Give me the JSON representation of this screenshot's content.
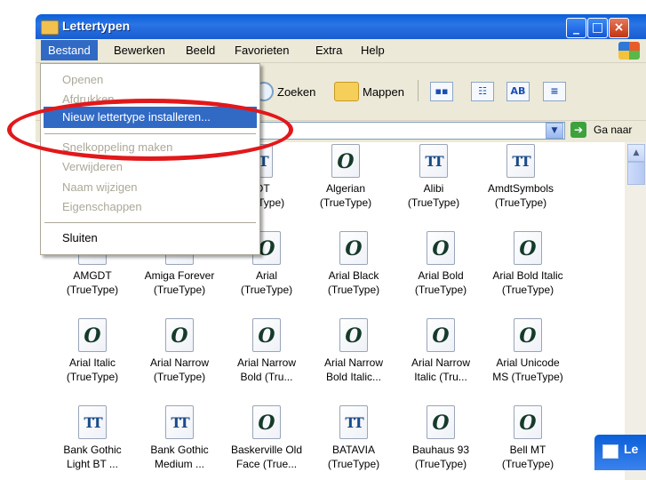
{
  "window": {
    "title": "Lettertypen"
  },
  "menubar": {
    "items": [
      "Bestand",
      "Bewerken",
      "Beeld",
      "Favorieten",
      "Extra",
      "Help"
    ]
  },
  "toolbar": {
    "zoeken": "Zoeken",
    "mappen": "Mappen",
    "view_ab": "AB"
  },
  "addressbar": {
    "go_label": "Ga naar"
  },
  "menu_bestand": {
    "items": [
      "Openen",
      "Afdrukken",
      "Nieuw lettertype installeren...",
      "Snelkoppeling maken",
      "Verwijderen",
      "Naam wijzigen",
      "Eigenschappen",
      "Sluiten"
    ]
  },
  "files": [
    {
      "name": "GDT\n(TrueType)",
      "icon": "tt"
    },
    {
      "name": "Algerian\n(TrueType)",
      "icon": "ot"
    },
    {
      "name": "Alibi\n(TrueType)",
      "icon": "tt"
    },
    {
      "name": "AmdtSymbols\n(TrueType)",
      "icon": "tt"
    },
    {
      "name": "AMGDT\n(TrueType)",
      "icon": "tt"
    },
    {
      "name": "Amiga Forever\n(TrueType)",
      "icon": "tt"
    },
    {
      "name": "Arial\n(TrueType)",
      "icon": "ot"
    },
    {
      "name": "Arial Black\n(TrueType)",
      "icon": "ot"
    },
    {
      "name": "Arial Bold\n(TrueType)",
      "icon": "ot"
    },
    {
      "name": "Arial Bold Italic\n(TrueType)",
      "icon": "ot"
    },
    {
      "name": "Arial Italic\n(TrueType)",
      "icon": "ot"
    },
    {
      "name": "Arial Narrow\n(TrueType)",
      "icon": "ot"
    },
    {
      "name": "Arial Narrow\nBold (Tru...",
      "icon": "ot"
    },
    {
      "name": "Arial Narrow\nBold Italic...",
      "icon": "ot"
    },
    {
      "name": "Arial Narrow\nItalic (Tru...",
      "icon": "ot"
    },
    {
      "name": "Arial Unicode\nMS (TrueType)",
      "icon": "ot"
    },
    {
      "name": "Bank Gothic\nLight BT ...",
      "icon": "tt"
    },
    {
      "name": "Bank Gothic\nMedium ...",
      "icon": "tt"
    },
    {
      "name": "Baskerville Old\nFace (True...",
      "icon": "ot"
    },
    {
      "name": "BATAVIA\n(TrueType)",
      "icon": "tt"
    },
    {
      "name": "Bauhaus 93\n(TrueType)",
      "icon": "ot"
    },
    {
      "name": "Bell MT\n(TrueType)",
      "icon": "ot"
    }
  ],
  "glyphs": {
    "ot": "O",
    "tt": "TT"
  },
  "mini_window": {
    "title": "Le"
  }
}
